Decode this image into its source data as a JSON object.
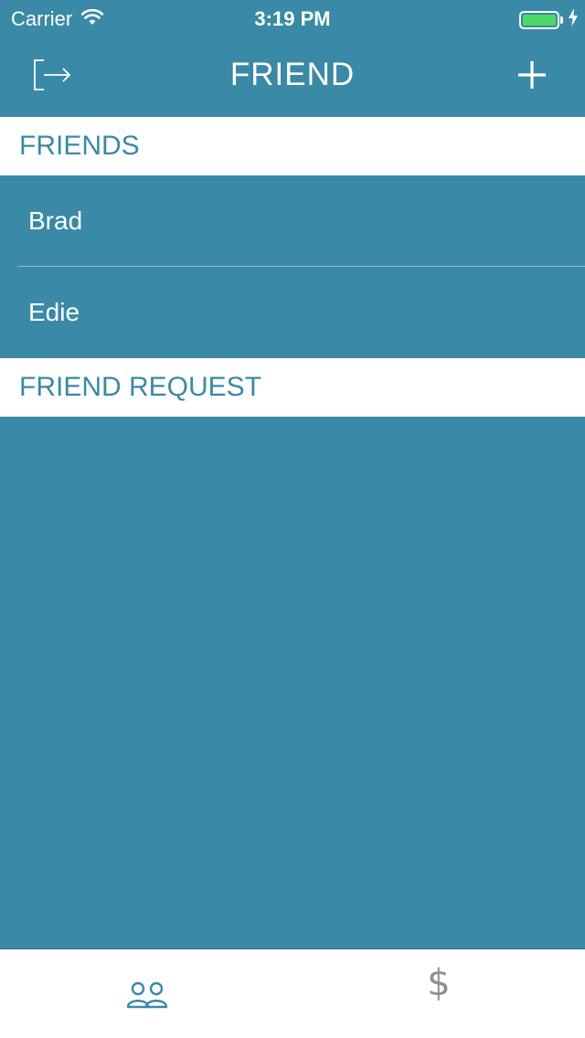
{
  "status_bar": {
    "carrier": "Carrier",
    "time": "3:19 PM",
    "battery_color": "#4cd964",
    "icons": [
      "wifi-icon",
      "battery-icon",
      "charging-bolt-icon"
    ]
  },
  "nav": {
    "title": "FRIEND",
    "left_icon": "logout-icon",
    "right_icon": "add-icon"
  },
  "sections": {
    "friends_header": "FRIENDS",
    "requests_header": "FRIEND REQUEST"
  },
  "friends": [
    {
      "name": "Brad"
    },
    {
      "name": "Edie"
    }
  ],
  "tab_bar": {
    "tabs": [
      {
        "icon": "friends-icon",
        "selected": true
      },
      {
        "icon": "dollar-icon",
        "glyph": "$",
        "selected": false
      }
    ]
  },
  "colors": {
    "primary": "#3a89a6",
    "white": "#ffffff",
    "inactive_tab": "#8e8e93"
  }
}
